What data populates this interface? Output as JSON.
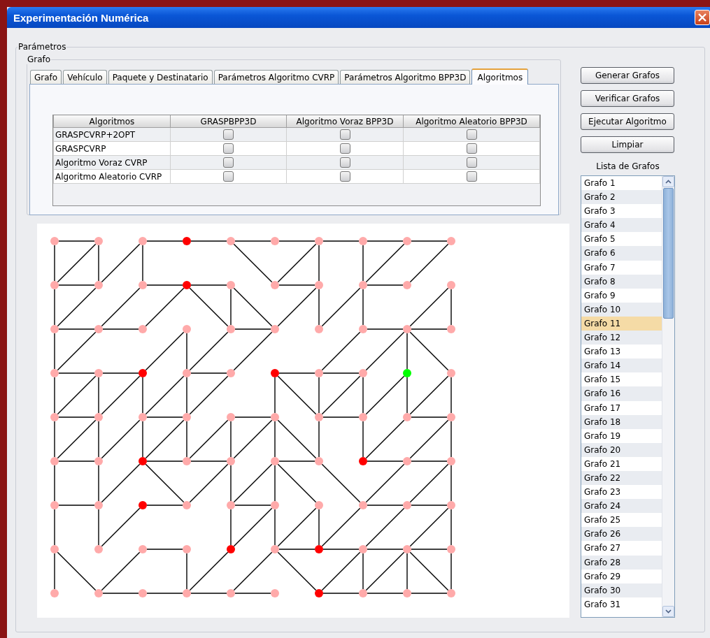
{
  "window": {
    "title": "Experimentación Numérica"
  },
  "parameters": {
    "legend": "Parámetros"
  },
  "graph_group": {
    "legend": "Grafo"
  },
  "tabs": [
    {
      "label": "Grafo",
      "selected": false
    },
    {
      "label": "Vehículo",
      "selected": false
    },
    {
      "label": "Paquete y Destinatario",
      "selected": false
    },
    {
      "label": "Parámetros Algoritmo CVRP",
      "selected": false
    },
    {
      "label": "Parámetros Algoritmo BPP3D",
      "selected": false
    },
    {
      "label": "Algoritmos",
      "selected": true
    }
  ],
  "table": {
    "columns": [
      "Algoritmos",
      "GRASPBPP3D",
      "Algoritmo Voraz BPP3D",
      "Algoritmo Aleatorio BPP3D"
    ],
    "rows": [
      {
        "name": "GRASPCVRP+2OPT",
        "cells": [
          {
            "checked": false
          },
          {
            "checked": false
          },
          {
            "checked": false
          }
        ]
      },
      {
        "name": "GRASPCVRP",
        "cells": [
          {
            "checked": false
          },
          {
            "checked": false
          },
          {
            "checked": false
          }
        ]
      },
      {
        "name": "Algoritmo Voraz CVRP",
        "cells": [
          {
            "checked": false
          },
          {
            "checked": false
          },
          {
            "checked": false
          }
        ]
      },
      {
        "name": "Algoritmo Aleatorio CVRP",
        "cells": [
          {
            "checked": false
          },
          {
            "checked": false
          },
          {
            "checked": false
          }
        ]
      }
    ]
  },
  "graph": {
    "rows": [
      [
        {
          "color": "#ffaaaa",
          "right": true,
          "down": true
        },
        {
          "color": "#ffaaaa",
          "down": true
        },
        {
          "color": "#ffaaaa",
          "right": true,
          "down": true
        },
        {
          "color": "#ff0000",
          "right": true
        },
        {
          "color": "#ffaaaa",
          "right": true,
          "down_right": true
        },
        {
          "color": "#ffaaaa",
          "right": true
        },
        {
          "color": "#ffaaaa",
          "right": true,
          "down": true
        },
        {
          "color": "#ffaaaa",
          "right": true,
          "down": true
        },
        {
          "color": "#ffaaaa",
          "right": true
        },
        {
          "color": "#ffaaaa"
        }
      ],
      [
        {
          "color": "#ffaaaa",
          "right": true,
          "down": true,
          "up_right": true
        },
        {
          "color": "#ffaaaa",
          "up_right": true
        },
        {
          "color": "#ffaaaa",
          "right": true
        },
        {
          "color": "#ff0000",
          "right": true,
          "down_right": true
        },
        {
          "color": "#ffaaaa",
          "down": true,
          "down_right": true
        },
        {
          "color": "#ffaaaa",
          "right": true,
          "up_right": true
        },
        {
          "color": "#ffaaaa",
          "down": true
        },
        {
          "color": "#ffaaaa",
          "right": true,
          "down": true,
          "up_right": true
        },
        {
          "color": "#ffaaaa",
          "up_right": true
        },
        {
          "color": "#ffaaaa",
          "down": true
        }
      ],
      [
        {
          "color": "#ffaaaa",
          "right": true,
          "down": true,
          "up_right": true
        },
        {
          "color": "#ffaaaa",
          "right": true,
          "up_right": true
        },
        {
          "color": "#ffaaaa",
          "up_right": true
        },
        {
          "color": "#ffaaaa",
          "down": true
        },
        {
          "color": "#ffaaaa",
          "right": true
        },
        {
          "color": "#ffaaaa",
          "up_right": true
        },
        {
          "color": "#ffaaaa",
          "up_right": true
        },
        {
          "color": "#ffaaaa",
          "right": true
        },
        {
          "color": "#ffaaaa",
          "right": true,
          "down": true,
          "down_right": true,
          "up_right": true
        },
        {
          "color": "#ffaaaa"
        }
      ],
      [
        {
          "color": "#ffaaaa",
          "right": true,
          "down": true,
          "up_right": true
        },
        {
          "color": "#ffaaaa",
          "right": true,
          "down": true
        },
        {
          "color": "#ff0000",
          "down": true,
          "up_right": true
        },
        {
          "color": "#ffaaaa",
          "right": true,
          "down": true,
          "up_right": true
        },
        {
          "color": "#ffaaaa",
          "up_right": true
        },
        {
          "color": "#ff0000",
          "right": true,
          "down": true,
          "down_right": true
        },
        {
          "color": "#ffaaaa",
          "right": true,
          "down": true,
          "up_right": true
        },
        {
          "color": "#ffaaaa",
          "down": true,
          "up_right": true
        },
        {
          "color": "#00ff00",
          "down": true
        },
        {
          "color": "#ffaaaa",
          "down": true
        }
      ],
      [
        {
          "color": "#ffaaaa",
          "right": true,
          "down": true,
          "up_right": true
        },
        {
          "color": "#ffaaaa",
          "down": true,
          "up_right": true
        },
        {
          "color": "#ffaaaa",
          "right": true,
          "down": true,
          "up_right": true
        },
        {
          "color": "#ffaaaa",
          "down": true,
          "up_right": true
        },
        {
          "color": "#ffaaaa",
          "right": true,
          "down": true
        },
        {
          "color": "#ffaaaa",
          "down": true,
          "down_right": true
        },
        {
          "color": "#ffaaaa",
          "right": true,
          "down": true,
          "up_right": true
        },
        {
          "color": "#ffaaaa",
          "down": true,
          "up_right": true
        },
        {
          "color": "#ffaaaa",
          "right": true,
          "up_right": true
        },
        {
          "color": "#ffaaaa",
          "down": true
        }
      ],
      [
        {
          "color": "#ffaaaa",
          "right": true,
          "down": true,
          "up_right": true
        },
        {
          "color": "#ffaaaa",
          "down": true,
          "up_right": true
        },
        {
          "color": "#ff0000",
          "right": true,
          "down_right": true,
          "up_right": true
        },
        {
          "color": "#ffaaaa",
          "right": true,
          "up_right": true
        },
        {
          "color": "#ffaaaa",
          "down": true,
          "up_right": true
        },
        {
          "color": "#ffaaaa",
          "right": true,
          "down": true,
          "down_right": true
        },
        {
          "color": "#ffaaaa",
          "down_right": true
        },
        {
          "color": "#ff0000",
          "right": true,
          "up_right": true
        },
        {
          "color": "#ffaaaa",
          "right": true,
          "up_right": true
        },
        {
          "color": "#ffaaaa",
          "down": true
        }
      ],
      [
        {
          "color": "#ffaaaa",
          "right": true,
          "down": true
        },
        {
          "color": "#ffaaaa",
          "down": true,
          "up_right": true
        },
        {
          "color": "#ff0000",
          "right": true
        },
        {
          "color": "#ffaaaa",
          "up_right": true
        },
        {
          "color": "#ffaaaa",
          "right": true,
          "down": true,
          "up_right": true
        },
        {
          "color": "#ffaaaa",
          "down": true
        },
        {
          "color": "#ffaaaa",
          "down": true
        },
        {
          "color": "#ffaaaa",
          "right": true,
          "up_right": true
        },
        {
          "color": "#ffaaaa",
          "right": true,
          "up_right": true
        },
        {
          "color": "#ffaaaa",
          "down": true
        }
      ],
      [
        {
          "color": "#ffaaaa",
          "down": true,
          "down_right": true
        },
        {
          "color": "#ffaaaa",
          "up_right": true
        },
        {
          "color": "#ffaaaa",
          "right": true
        },
        {
          "color": "#ffaaaa",
          "down": true
        },
        {
          "color": "#ff0000",
          "up_right": true
        },
        {
          "color": "#ffaaaa",
          "right": true,
          "down_right": true,
          "up_right": true
        },
        {
          "color": "#ff0000",
          "right": true,
          "up_right": true
        },
        {
          "color": "#ffaaaa",
          "right": true,
          "down": true,
          "up_right": true
        },
        {
          "color": "#ffaaaa",
          "right": true,
          "down": true,
          "down_right": true,
          "up_right": true
        },
        {
          "color": "#ffaaaa",
          "down": true
        }
      ],
      [
        {
          "color": "#ffaaaa"
        },
        {
          "color": "#ffaaaa",
          "right": true,
          "up_right": true
        },
        {
          "color": "#ffaaaa",
          "right": true
        },
        {
          "color": "#ffaaaa",
          "right": true,
          "up_right": true
        },
        {
          "color": "#ffaaaa",
          "right": true,
          "up_right": true
        },
        {
          "color": "#ffaaaa"
        },
        {
          "color": "#ff0000",
          "right": true,
          "up_right": true
        },
        {
          "color": "#ffaaaa",
          "right": true,
          "up_right": true
        },
        {
          "color": "#ffaaaa",
          "right": true
        },
        {
          "color": "#ffaaaa"
        }
      ]
    ]
  },
  "buttons": [
    "Generar Grafos",
    "Verificar Grafos",
    "Ejecutar Algoritmo",
    "Limpiar"
  ],
  "graph_list": {
    "label": "Lista de Grafos",
    "items": [
      {
        "label": "Grafo 1",
        "selected": false
      },
      {
        "label": "Grafo 2",
        "selected": false
      },
      {
        "label": "Grafo 3",
        "selected": false
      },
      {
        "label": "Grafo 4",
        "selected": false
      },
      {
        "label": "Grafo 5",
        "selected": false
      },
      {
        "label": "Grafo 6",
        "selected": false
      },
      {
        "label": "Grafo 7",
        "selected": false
      },
      {
        "label": "Grafo 8",
        "selected": false
      },
      {
        "label": "Grafo 9",
        "selected": false
      },
      {
        "label": "Grafo 10",
        "selected": false
      },
      {
        "label": "Grafo 11",
        "selected": true
      },
      {
        "label": "Grafo 12",
        "selected": false
      },
      {
        "label": "Grafo 13",
        "selected": false
      },
      {
        "label": "Grafo 14",
        "selected": false
      },
      {
        "label": "Grafo 15",
        "selected": false
      },
      {
        "label": "Grafo 16",
        "selected": false
      },
      {
        "label": "Grafo 17",
        "selected": false
      },
      {
        "label": "Grafo 18",
        "selected": false
      },
      {
        "label": "Grafo 19",
        "selected": false
      },
      {
        "label": "Grafo 20",
        "selected": false
      },
      {
        "label": "Grafo 21",
        "selected": false
      },
      {
        "label": "Grafo 22",
        "selected": false
      },
      {
        "label": "Grafo 23",
        "selected": false
      },
      {
        "label": "Grafo 24",
        "selected": false
      },
      {
        "label": "Grafo 25",
        "selected": false
      },
      {
        "label": "Grafo 26",
        "selected": false
      },
      {
        "label": "Grafo 27",
        "selected": false
      },
      {
        "label": "Grafo 28",
        "selected": false
      },
      {
        "label": "Grafo 29",
        "selected": false
      },
      {
        "label": "Grafo 30",
        "selected": false
      },
      {
        "label": "Grafo 31",
        "selected": false
      }
    ]
  }
}
